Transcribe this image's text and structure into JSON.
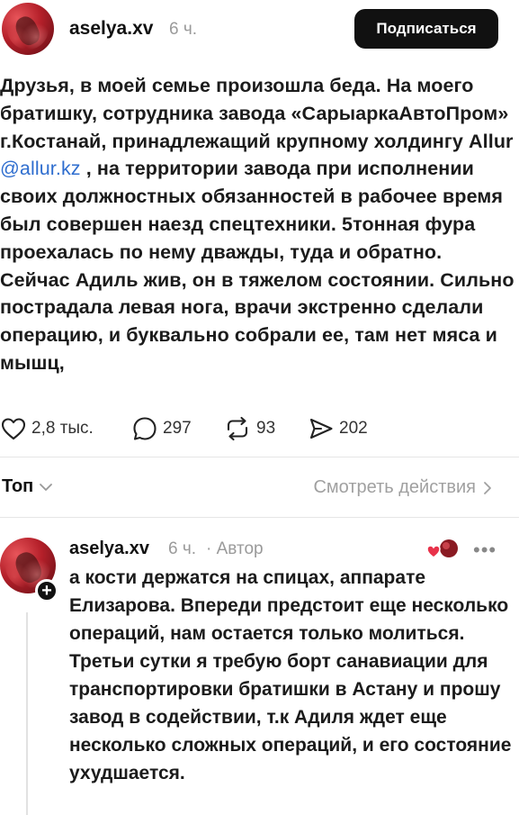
{
  "post": {
    "username": "aselya.xv",
    "time": "6 ч.",
    "follow_label": "Подписаться",
    "text_before_mention": "Друзья, в моей семье произошла беда. На моего братишку, сотрудника завода «СарыаркаАвтоПром» г.Костанай, принадлежащий крупному холдингу Allur",
    "mention": "@allur.kz",
    "text_after_mention": ", на территории завода при исполнении своих должностных обязанностей в рабочее время был совершен наезд спецтехники. 5тонная фура проехалась по нему дважды, туда и обратно. Сейчас Адиль жив, он в тяжелом состоянии. Сильно пострадала левая нога, врачи экстренно сделали операцию, и буквально собрали ее, там нет мяса и мышц,",
    "likes": "2,8 тыс.",
    "comments": "297",
    "reposts": "93",
    "shares": "202"
  },
  "thread_bar": {
    "sort_label": "Топ",
    "view_activity_label": "Смотреть действия"
  },
  "reply": {
    "username": "aselya.xv",
    "time": "6 ч.",
    "author_tag": "· Автор",
    "text": "а кости держатся на спицах, аппарате Елизарова. Впереди предстоит еще несколько операций, нам остается только молиться. Третьи сутки я требую борт санавиации для транспортировки братишки в Астану и прошу завод в содействии, т.к Адиля ждет еще несколько сложных операций, и его состояние ухудшается."
  },
  "icons": {
    "like": "heart-icon",
    "comment": "comment-bubble-icon",
    "repost": "repost-icon",
    "share": "send-icon",
    "sort": "chevron-down-icon",
    "view_activity": "chevron-right-icon",
    "more": "more-dots-icon",
    "follow_plus": "plus-icon"
  },
  "colors": {
    "mention": "#2f6ecf",
    "follow_button": "#111111",
    "muted_text": "#9a9a9a",
    "like_badge": "#e8324a"
  }
}
